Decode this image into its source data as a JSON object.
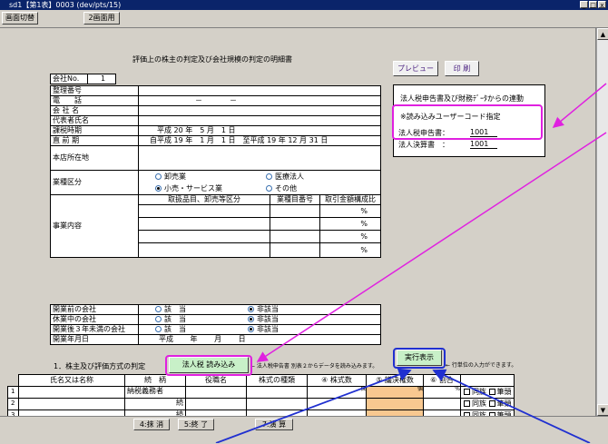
{
  "window": {
    "title": "sd1【第1表】0003 (dev/pts/15)",
    "min": "_",
    "max": "□",
    "close": "x"
  },
  "toolbar": {
    "btn1": "画面切替",
    "btn2": "2画面用"
  },
  "form": {
    "title": "評価上の株主の判定及び会社規模の判定の明細書",
    "company_no_label": "会社No.",
    "company_no": "1",
    "preview": "プレビュー",
    "print": "印 刷",
    "rows": {
      "seiri": "整理番号",
      "tel": "電　　話",
      "tel_dash1": "－",
      "tel_dash2": "－",
      "kaisha": "会 社 名",
      "daihyo": "代表者氏名",
      "kazei": "課税時期",
      "chokuzen": "直 前 期",
      "honten": "本店所在地",
      "gyoshu": "業種区分",
      "jigyo": "事業内容"
    },
    "kazei_val": "平成 20 年　5 月　1 日",
    "chokuzen_val": "自平成 19 年　1 月　1 日　至平成 19 年 12 月 31 日",
    "gyoshu_opts": [
      "卸売業",
      "医療法人",
      "小売・サービス業",
      "その他"
    ],
    "jigyo_h1": "取扱品目、卸売等区分",
    "jigyo_h2": "業種目番号",
    "jigyo_h3": "取引金額構成比",
    "pct": "%",
    "status_rows": [
      {
        "label": "開業前の会社",
        "a": "該　当",
        "b": "非該当"
      },
      {
        "label": "休業中の会社",
        "a": "該　当",
        "b": "非該当"
      },
      {
        "label": "開業後３年未満の会社",
        "a": "該　当",
        "b": "非該当"
      }
    ],
    "kaigyo_label": "開業年月日",
    "kaigyo_val": "平成　　 年　　 月　　 日",
    "section1": "1．株主及び評価方式の判定",
    "houjin_btn": "法人税 読み込み",
    "houjin_note": "← 法人税申告書 別表２からデータを読み込みます。",
    "jikko_btn": "実行表示",
    "jikko_note": "← 行単位の入力ができます。",
    "table_h": [
      "氏名又は名称",
      "続　柄",
      "役職名",
      "株式の種類",
      "④ 株式数",
      "⑤ 議決権数",
      "⑥ 割合"
    ],
    "unit_kabu": "株",
    "unit_ko": "個",
    "unit_pct": "%",
    "table_rows": [
      {
        "n": "1",
        "zoku": "納税義務者"
      },
      {
        "n": "2",
        "zoku": "続"
      },
      {
        "n": "3",
        "zoku": "続"
      }
    ],
    "douzoku": "同族",
    "hittou": "筆頭",
    "panel": {
      "title": "法人税申告書及び財務ﾃﾞｰﾀからの連動",
      "note": "※読み込みユーザーコード指定",
      "l1": "法人税申告書：",
      "v1": "1001",
      "l2": "法人決算書　：",
      "v2": "1001"
    }
  },
  "fkeys": {
    "f4": "4:抹 消",
    "f5": "5:終 了",
    "f7": "7:演 算"
  },
  "colors": {
    "green_btn": "#c8f0c8",
    "orange": "#f8c890",
    "annot_magenta": "#e020e0",
    "annot_blue": "#2030d0"
  }
}
